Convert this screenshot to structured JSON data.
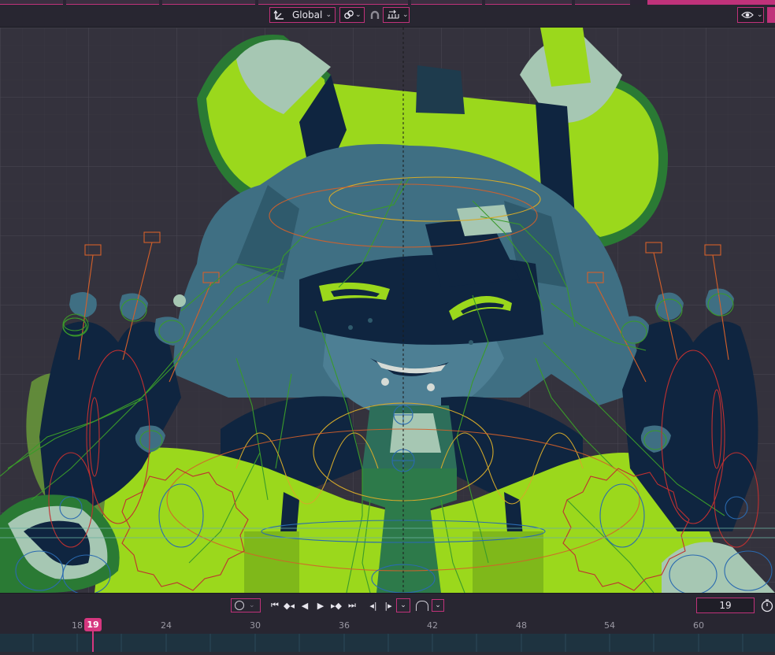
{
  "header": {
    "orientation_label": "Global",
    "orientation_icon": "transform-orientation-icon",
    "pivot_icon": "pivot-point-icon",
    "snap_icon": "snap-magnet-icon",
    "snap_target_icon": "snap-increment-icon",
    "overlay_icon": "overlay-visibility-icon"
  },
  "viewport": {
    "content": "3D character rig with armature bones, control shapes and gears"
  },
  "playback": {
    "keying_icon": "record-keyframe-icon",
    "jump_start_icon": "jump-to-start-icon",
    "prev_keyframe_icon": "jump-prev-keyframe-icon",
    "play_reverse_icon": "play-reverse-icon",
    "play_icon": "play-icon",
    "next_keyframe_icon": "jump-next-keyframe-icon",
    "jump_end_icon": "jump-to-end-icon",
    "prev_frame_icon": "step-back-icon",
    "next_frame_icon": "step-forward-icon",
    "current_frame": "19",
    "stopwatch_icon": "stopwatch-icon"
  },
  "timeline": {
    "ticks": [
      "18",
      "24",
      "30",
      "36",
      "42",
      "48",
      "54",
      "60"
    ],
    "playhead_label": "19"
  },
  "colors": {
    "accent": "#c0327a",
    "lime": "#9bd81c",
    "navy": "#0f2540",
    "teal": "#3f6f83",
    "bone_green": "#3a9a2a",
    "gear_red": "#c03030"
  }
}
